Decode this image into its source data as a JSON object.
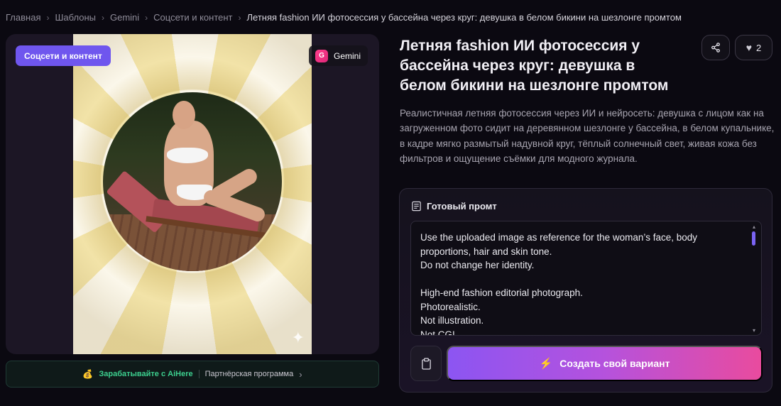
{
  "breadcrumb": {
    "items": [
      "Главная",
      "Шаблоны",
      "Gemini",
      "Соцсети и контент"
    ],
    "current": "Летняя fashion ИИ фотосессия у бассейна через круг: девушка в белом бикини на шезлонге промтом"
  },
  "card": {
    "category": "Соцсети и контент",
    "model_letter": "G",
    "model_name": "Gemini"
  },
  "partner": {
    "earn_label": "Зарабатывайте с AiHere",
    "program_label": "Партнёрская программа"
  },
  "detail": {
    "title": "Летняя fashion ИИ фотосессия у бассейна через круг: девушка в белом бикини на шезлонге промтом",
    "likes": "2",
    "description": "Реалистичная летняя фотосессия через ИИ и нейросеть: девушка с лицом как на загруженном фото сидит на деревянном шезлонге у бассейна, в белом купальнике, в кадре мягко размытый надувной круг, тёплый солнечный свет, живая кожа без фильтров и ощущение съёмки для модного журнала."
  },
  "prompt": {
    "heading": "Готовый промт",
    "text": "Use the uploaded image as reference for the woman’s face, body proportions, hair and skin tone.\nDo not change her identity.\n\nHigh-end fashion editorial photograph.\nPhotorealistic.\nNot illustration.\nNot CGI.",
    "create_label": "Создать свой вариант"
  },
  "colors": {
    "accent": "#6f56ee",
    "gradient_start": "#8c55f2",
    "gradient_end": "#e94b9e",
    "earn_green": "#3ccf8e"
  },
  "icons": {
    "share": "share-icon",
    "heart": "heart-icon",
    "copy": "clipboard-icon",
    "bolt": "lightning-icon",
    "doc": "document-icon",
    "coin": "money-bag-icon",
    "sparkle": "sparkle-icon"
  }
}
